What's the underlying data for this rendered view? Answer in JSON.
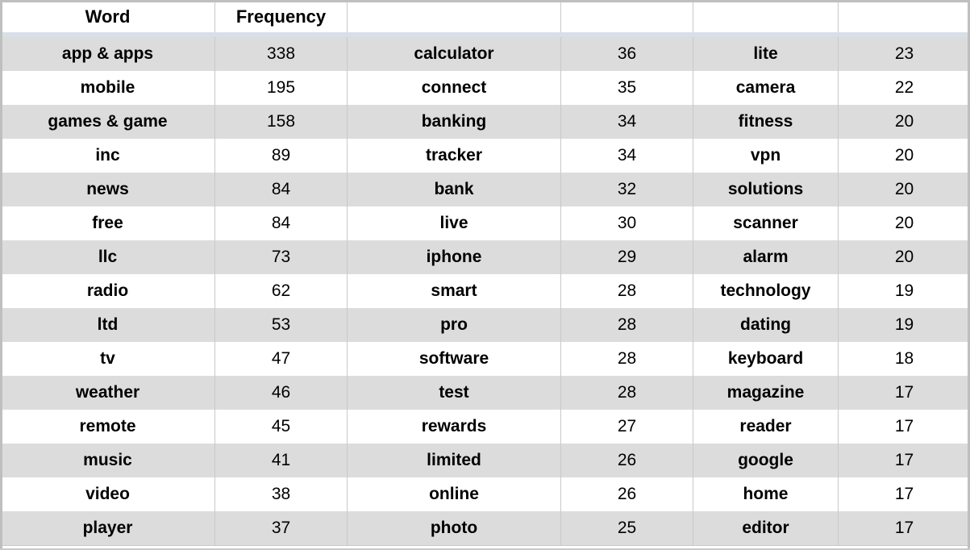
{
  "table": {
    "headers": [
      "Word",
      "Frequency",
      "",
      "",
      "",
      ""
    ],
    "columns": 6,
    "row_count": 15,
    "colors": {
      "shaded_row": "#dcdcdc",
      "plain_row": "#ffffff",
      "grid_line": "#c9c9c9",
      "frame": "#bfbfbf",
      "header_separator": "#d9dfe8",
      "text": "#000000"
    },
    "rows": [
      {
        "word1": "app & apps",
        "freq1": "338",
        "word2": "calculator",
        "freq2": "36",
        "word3": "lite",
        "freq3": "23"
      },
      {
        "word1": "mobile",
        "freq1": "195",
        "word2": "connect",
        "freq2": "35",
        "word3": "camera",
        "freq3": "22"
      },
      {
        "word1": "games & game",
        "freq1": "158",
        "word2": "banking",
        "freq2": "34",
        "word3": "fitness",
        "freq3": "20"
      },
      {
        "word1": "inc",
        "freq1": "89",
        "word2": "tracker",
        "freq2": "34",
        "word3": "vpn",
        "freq3": "20"
      },
      {
        "word1": "news",
        "freq1": "84",
        "word2": "bank",
        "freq2": "32",
        "word3": "solutions",
        "freq3": "20"
      },
      {
        "word1": "free",
        "freq1": "84",
        "word2": "live",
        "freq2": "30",
        "word3": "scanner",
        "freq3": "20"
      },
      {
        "word1": "llc",
        "freq1": "73",
        "word2": "iphone",
        "freq2": "29",
        "word3": "alarm",
        "freq3": "20"
      },
      {
        "word1": "radio",
        "freq1": "62",
        "word2": "smart",
        "freq2": "28",
        "word3": "technology",
        "freq3": "19"
      },
      {
        "word1": "ltd",
        "freq1": "53",
        "word2": "pro",
        "freq2": "28",
        "word3": "dating",
        "freq3": "19"
      },
      {
        "word1": "tv",
        "freq1": "47",
        "word2": "software",
        "freq2": "28",
        "word3": "keyboard",
        "freq3": "18"
      },
      {
        "word1": "weather",
        "freq1": "46",
        "word2": "test",
        "freq2": "28",
        "word3": "magazine",
        "freq3": "17"
      },
      {
        "word1": "remote",
        "freq1": "45",
        "word2": "rewards",
        "freq2": "27",
        "word3": "reader",
        "freq3": "17"
      },
      {
        "word1": "music",
        "freq1": "41",
        "word2": "limited",
        "freq2": "26",
        "word3": "google",
        "freq3": "17"
      },
      {
        "word1": "video",
        "freq1": "38",
        "word2": "online",
        "freq2": "26",
        "word3": "home",
        "freq3": "17"
      },
      {
        "word1": "player",
        "freq1": "37",
        "word2": "photo",
        "freq2": "25",
        "word3": "editor",
        "freq3": "17"
      }
    ]
  },
  "chart_data": {
    "type": "table",
    "title": "",
    "columns": [
      "Word",
      "Frequency",
      "Word",
      "Frequency",
      "Word",
      "Frequency"
    ],
    "categories": [
      "app & apps",
      "mobile",
      "games & game",
      "inc",
      "news",
      "free",
      "llc",
      "radio",
      "ltd",
      "tv",
      "weather",
      "remote",
      "music",
      "video",
      "player",
      "calculator",
      "connect",
      "banking",
      "tracker",
      "bank",
      "live",
      "iphone",
      "smart",
      "pro",
      "software",
      "test",
      "rewards",
      "limited",
      "online",
      "photo",
      "lite",
      "camera",
      "fitness",
      "vpn",
      "solutions",
      "scanner",
      "alarm",
      "technology",
      "dating",
      "keyboard",
      "magazine",
      "reader",
      "google",
      "home",
      "editor"
    ],
    "values": [
      338,
      195,
      158,
      89,
      84,
      84,
      73,
      62,
      53,
      47,
      46,
      45,
      41,
      38,
      37,
      36,
      35,
      34,
      34,
      32,
      30,
      29,
      28,
      28,
      28,
      28,
      27,
      26,
      26,
      25,
      23,
      22,
      20,
      20,
      20,
      20,
      20,
      19,
      19,
      18,
      17,
      17,
      17,
      17,
      17
    ],
    "xlabel": "Word",
    "ylabel": "Frequency"
  }
}
